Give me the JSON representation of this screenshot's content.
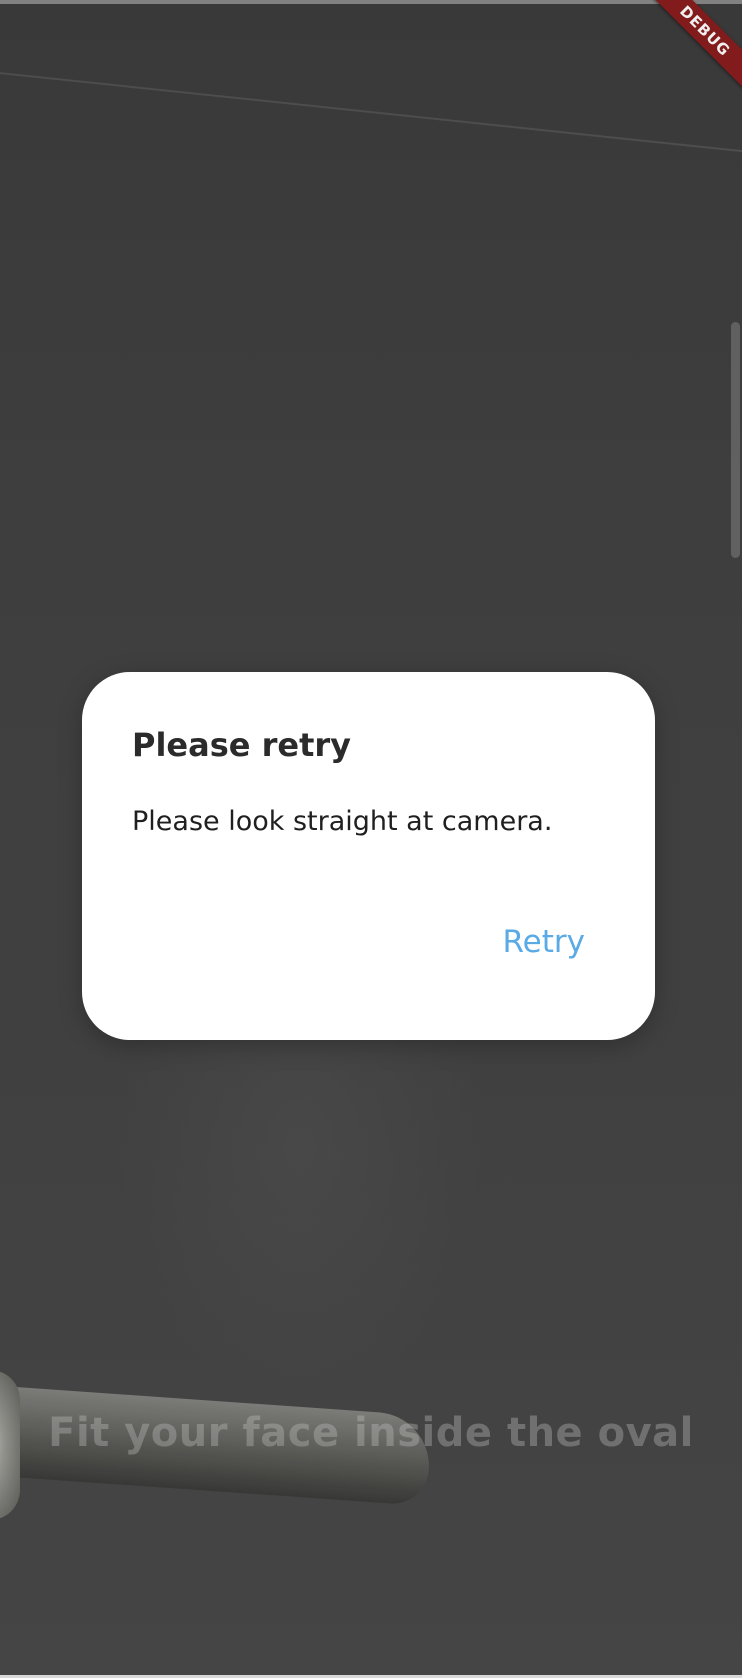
{
  "debug_banner": {
    "label": "DEBUG",
    "color": "#8b1d1d"
  },
  "camera_view": {
    "hint": "Fit your face inside the oval"
  },
  "dialog": {
    "title": "Please retry",
    "message": "Please look straight at camera.",
    "action_label": "Retry",
    "action_color": "#5aaae6"
  }
}
